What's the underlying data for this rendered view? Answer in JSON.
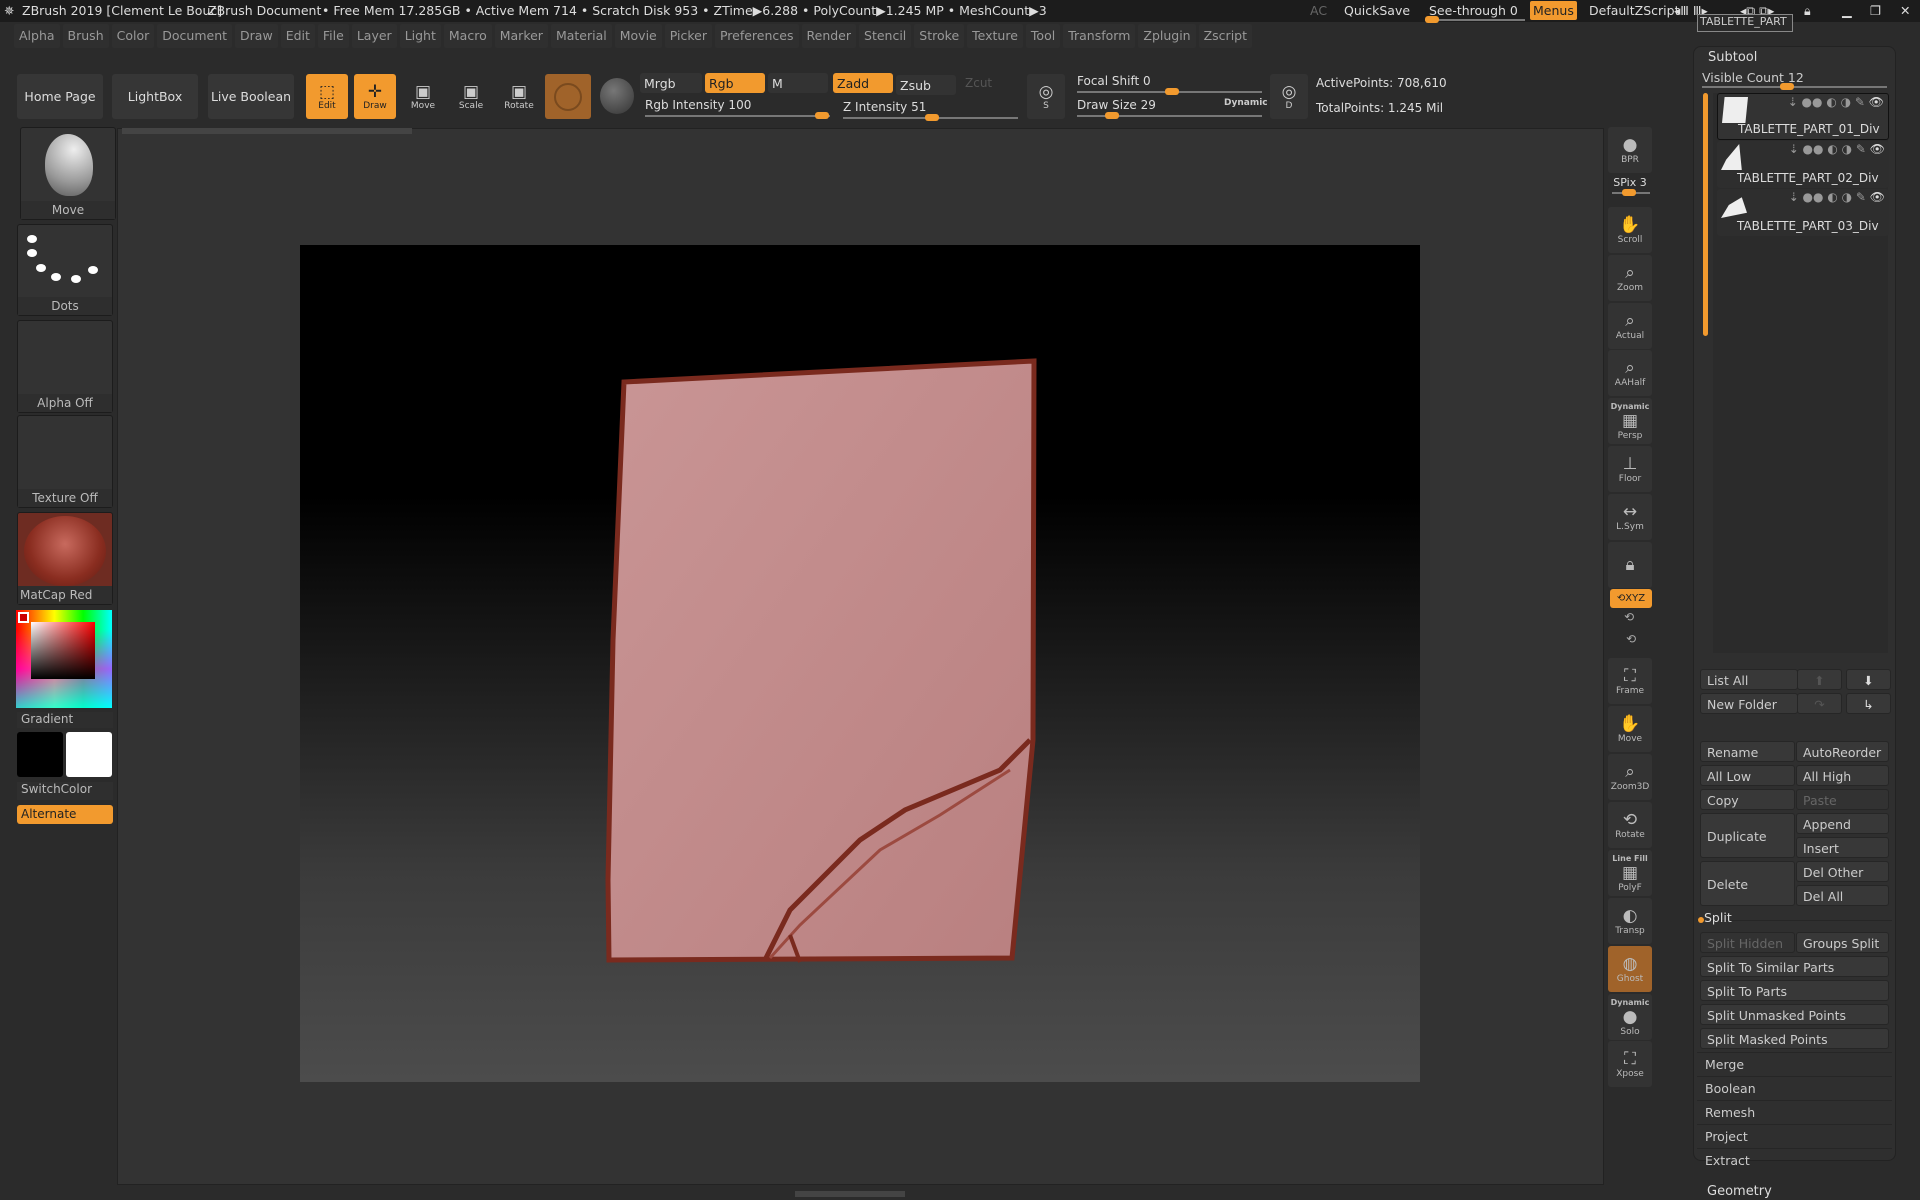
{
  "titlebar": {
    "app": "ZBrush 2019 [Clement Le Bouc]",
    "document": "ZBrush Document",
    "stats": "• Free Mem 17.285GB • Active Mem 714 • Scratch Disk 953 • ZTime▶6.288 • PolyCount▶1.245 MP • MeshCount▶3",
    "ac": "AC",
    "quicksave": "QuickSave",
    "seethrough": "See-through  0",
    "menus": "Menus",
    "script": "DefaultZScript"
  },
  "menus": [
    "Alpha",
    "Brush",
    "Color",
    "Document",
    "Draw",
    "Edit",
    "File",
    "Layer",
    "Light",
    "Macro",
    "Marker",
    "Material",
    "Movie",
    "Picker",
    "Preferences",
    "Render",
    "Stencil",
    "Stroke",
    "Texture",
    "Tool",
    "Transform",
    "Zplugin",
    "Zscript"
  ],
  "toolbar": {
    "home": "Home Page",
    "lightbox": "LightBox",
    "liveboolean": "Live Boolean",
    "edit": "Edit",
    "draw": "Draw",
    "move": "Move",
    "scale": "Scale",
    "rotate": "Rotate",
    "mrgb": "Mrgb",
    "rgb": "Rgb",
    "m": "M",
    "zadd": "Zadd",
    "zsub": "Zsub",
    "zcut": "Zcut",
    "rgb_intensity": "Rgb Intensity 100",
    "z_intensity": "Z Intensity 51",
    "focal_shift": "Focal Shift 0",
    "draw_size": "Draw Size 29",
    "dynamic": "Dynamic",
    "active_points": "ActivePoints: 708,610",
    "total_points": "TotalPoints: 1.245 Mil",
    "rgb_intensity_value": 100,
    "z_intensity_value": 51,
    "draw_size_value": 29
  },
  "left": {
    "brush": "Move",
    "stroke": "Dots",
    "alpha": "Alpha Off",
    "texture": "Texture Off",
    "material": "MatCap Red Wax",
    "gradient": "Gradient",
    "switchcolor": "SwitchColor",
    "alternate": "Alternate"
  },
  "shelf": {
    "bpr": "BPR",
    "spix": "SPix 3",
    "scroll": "Scroll",
    "zoom": "Zoom",
    "actual": "Actual",
    "aahalf": "AAHalf",
    "dynamic": "Dynamic",
    "persp": "Persp",
    "floor": "Floor",
    "lsym": "L.Sym",
    "xyz": "XYZ",
    "frame": "Frame",
    "move": "Move",
    "zoom3d": "Zoom3D",
    "rotate": "Rotate",
    "linefill": "Line Fill",
    "polyf": "PolyF",
    "transp": "Transp",
    "ghost": "Ghost",
    "solo": "Solo",
    "xpose": "Xpose"
  },
  "subtool": {
    "top_name": "TABLETTE_PART",
    "title": "Subtool",
    "visible_count": "Visible Count 12",
    "items": [
      "TABLETTE_PART_01_Div",
      "TABLETTE_PART_02_Div",
      "TABLETTE_PART_03_Div"
    ],
    "list_all": "List All",
    "new_folder": "New Folder",
    "rename": "Rename",
    "autoreorder": "AutoReorder",
    "all_low": "All Low",
    "all_high": "All High",
    "copy": "Copy",
    "paste": "Paste",
    "duplicate": "Duplicate",
    "append": "Append",
    "insert": "Insert",
    "delete": "Delete",
    "del_other": "Del Other",
    "del_all": "Del All",
    "split": "Split",
    "split_hidden": "Split Hidden",
    "groups_split": "Groups Split",
    "split_similar": "Split To Similar Parts",
    "split_parts": "Split To Parts",
    "split_unmasked": "Split Unmasked Points",
    "split_masked": "Split Masked Points",
    "merge": "Merge",
    "boolean": "Boolean",
    "remesh": "Remesh",
    "project": "Project",
    "extract": "Extract",
    "geometry": "Geometry"
  },
  "colors": {
    "accent": "#f29a2e",
    "mesh": "#c98f8f",
    "crack": "#7a2a1e"
  }
}
